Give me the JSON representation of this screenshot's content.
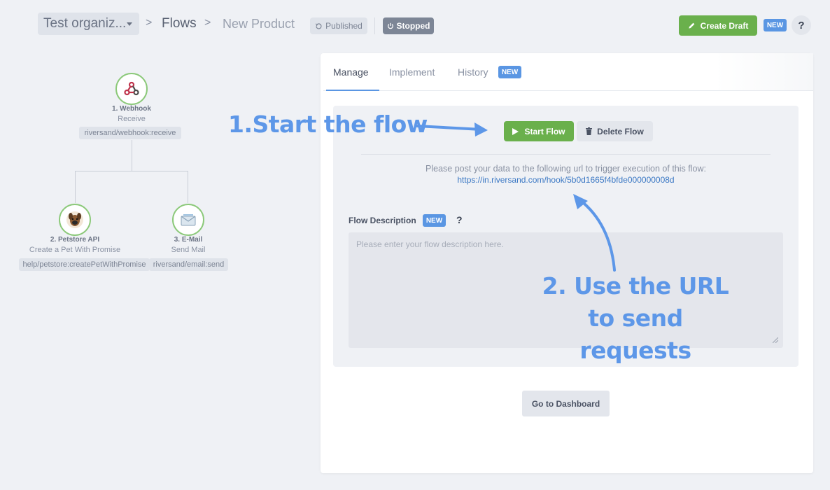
{
  "header": {
    "org_name": "Test organiz...",
    "breadcrumb_sep": ">",
    "flows_label": "Flows",
    "product_label": "New Product",
    "published_label": "Published",
    "stopped_label": "Stopped",
    "create_draft_label": "Create Draft",
    "new_badge": "NEW",
    "help": "?"
  },
  "flow": {
    "nodes": [
      {
        "title": "1. Webhook",
        "subtitle": "Receive",
        "path": "riversand/webhook:receive",
        "icon": "webhook-icon"
      },
      {
        "title": "2. Petstore API",
        "subtitle": "Create a Pet With Promise",
        "path": "help/petstore:createPetWithPromise",
        "icon": "petstore-icon"
      },
      {
        "title": "3. E-Mail",
        "subtitle": "Send Mail",
        "path": "riversand/email:send",
        "icon": "email-icon"
      }
    ]
  },
  "tabs": {
    "manage": "Manage",
    "implement": "Implement",
    "history": "History",
    "new_badge": "NEW"
  },
  "manage": {
    "start_flow_label": "Start Flow",
    "delete_flow_label": "Delete Flow",
    "post_text": "Please post your data to the following url to trigger execution of this flow:",
    "post_url": "https://in.riversand.com/hook/5b0d1665f4bfde000000008d",
    "description_label": "Flow Description",
    "description_new": "NEW",
    "description_help": "?",
    "description_placeholder": "Please enter your flow description here.",
    "dashboard_label": "Go to Dashboard"
  },
  "annotations": {
    "step1": "1.Start the flow",
    "step2_line1": "2. Use the URL",
    "step2_line2": "to send requests"
  },
  "colors": {
    "accent_green": "#6ab04c",
    "accent_blue": "#5a96e3",
    "annotation_blue": "#5d97e8",
    "background": "#eff1f5"
  }
}
